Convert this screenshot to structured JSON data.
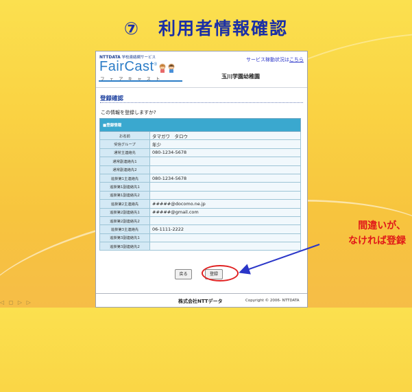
{
  "slide": {
    "title": "⑦　利用者情報確認",
    "annotation_line1": "間違いが、",
    "annotation_line2": "なければ登録"
  },
  "app": {
    "provider": "NTTDATA",
    "service_tagline": "学校連絡網サービス",
    "brand_name": "FairCast",
    "brand_mark": "®",
    "brand_kana": "フェアキャスト",
    "status_link_prefix": "サービス稼動状況は",
    "status_link_text": "こちら",
    "school_name": "玉川学園幼稚園"
  },
  "page": {
    "title": "登録確認",
    "prompt": "この情報を登録しますか?"
  },
  "table": {
    "section_label": "■登録情報",
    "rows": [
      {
        "label": "お名前",
        "value": "タマガワ　タロウ"
      },
      {
        "label": "受信グループ",
        "value": "年少"
      },
      {
        "label": "通常主連絡先",
        "value": "080-1234-5678"
      },
      {
        "label": "通常副連絡先1",
        "value": ""
      },
      {
        "label": "通常副連絡先2",
        "value": ""
      },
      {
        "label": "追掛第1主連絡先",
        "value": "080-1234-5678"
      },
      {
        "label": "追掛第1副連絡先1",
        "value": ""
      },
      {
        "label": "追掛第1副連絡先2",
        "value": ""
      },
      {
        "label": "追掛第2主連絡先",
        "value": "#####@docomo.ne.jp"
      },
      {
        "label": "追掛第2副連絡先1",
        "value": "#####@gmail.com"
      },
      {
        "label": "追掛第2副連絡先2",
        "value": ""
      },
      {
        "label": "追掛第3主連絡先",
        "value": "06-1111-2222"
      },
      {
        "label": "追掛第3副連絡先1",
        "value": ""
      },
      {
        "label": "追掛第3副連絡先2",
        "value": ""
      }
    ]
  },
  "buttons": {
    "back": "戻る",
    "register": "登録"
  },
  "footer": {
    "company": "株式会社NTTデータ",
    "copyright": "Copyright © 2006- NTTDATA"
  },
  "colors": {
    "title_blue": "#1b2fa6",
    "accent_red": "#e01818",
    "table_header": "#3aa8cf"
  }
}
